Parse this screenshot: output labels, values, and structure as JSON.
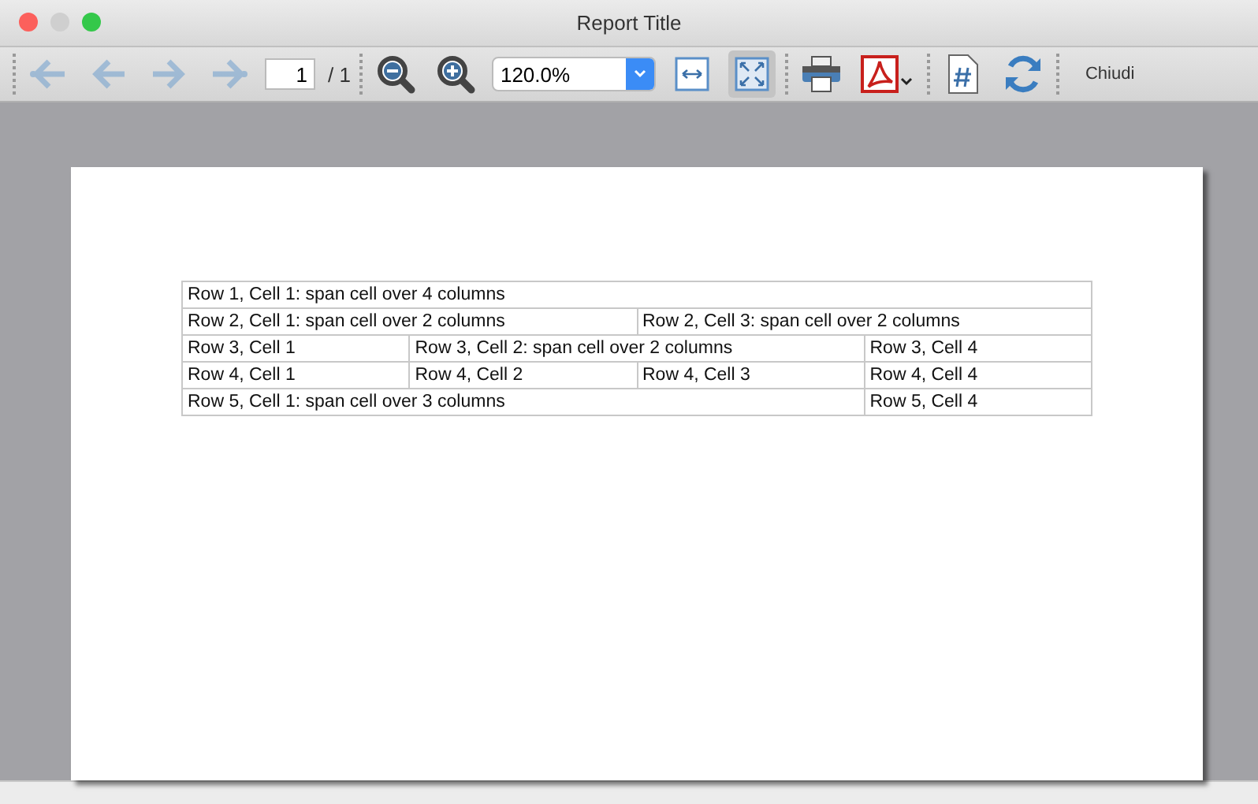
{
  "window": {
    "title": "Report Title"
  },
  "toolbar": {
    "groups": [
      [
        {
          "kind": "first",
          "disabled": true
        },
        {
          "kind": "prev",
          "disabled": true
        },
        {
          "kind": "next",
          "disabled": true
        },
        {
          "kind": "last",
          "disabled": true
        },
        {
          "kind": "page",
          "value": "1",
          "total": "/ 1"
        }
      ],
      [
        {
          "kind": "zoom-out",
          "disabled": false
        },
        {
          "kind": "zoom-in",
          "disabled": false
        },
        {
          "kind": "zoom-select",
          "value": "120.0%"
        },
        {
          "kind": "fit-width",
          "selected": false
        },
        {
          "kind": "fit-page",
          "selected": true
        }
      ],
      [
        {
          "kind": "print",
          "disabled": false
        },
        {
          "kind": "pdf",
          "disabled": false
        }
      ],
      [
        {
          "kind": "page-number",
          "disabled": false
        },
        {
          "kind": "refresh",
          "disabled": false
        }
      ],
      [
        {
          "kind": "close",
          "label": "Chiudi"
        }
      ]
    ]
  },
  "table": {
    "rows": [
      [
        {
          "text": "Row 1, Cell 1: span cell over 4 columns",
          "colspan": 4
        }
      ],
      [
        {
          "text": "Row 2, Cell 1: span cell over 2 columns",
          "colspan": 2
        },
        {
          "text": "Row 2, Cell 3: span cell over 2 columns",
          "colspan": 2
        }
      ],
      [
        {
          "text": "Row 3, Cell 1"
        },
        {
          "text": "Row 3, Cell 2: span cell over 2 columns",
          "colspan": 2
        },
        {
          "text": "Row 3, Cell 4"
        }
      ],
      [
        {
          "text": "Row 4, Cell 1"
        },
        {
          "text": "Row 4, Cell 2"
        },
        {
          "text": "Row 4, Cell 3"
        },
        {
          "text": "Row 4, Cell 4"
        }
      ],
      [
        {
          "text": "Row 5, Cell 1: span cell over 3 columns",
          "colspan": 3
        },
        {
          "text": "Row 5, Cell 4"
        }
      ]
    ]
  }
}
